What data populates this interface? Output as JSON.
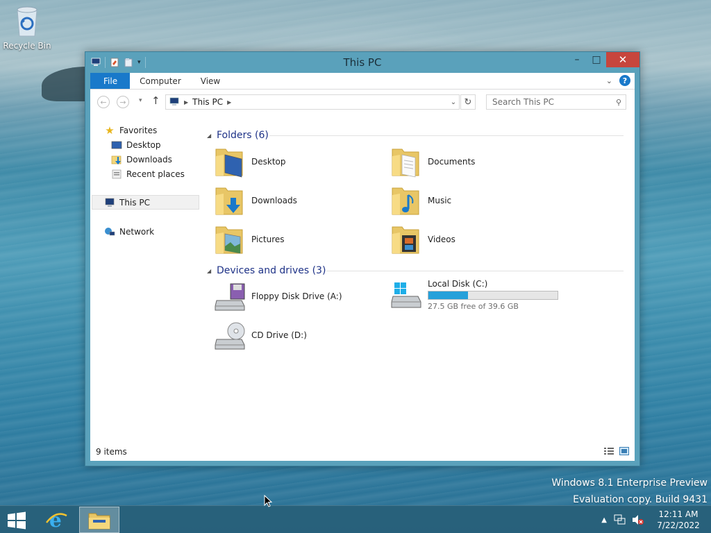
{
  "desktop": {
    "recycle_bin_label": "Recycle Bin",
    "watermark": {
      "line1": "Windows 8.1 Enterprise Preview",
      "line2": "Evaluation copy. Build 9431"
    }
  },
  "window": {
    "title": "This PC",
    "controls": {
      "minimize": "–",
      "maximize": "□",
      "close": "✕"
    },
    "ribbon": {
      "tabs": [
        "File",
        "Computer",
        "View"
      ],
      "help_label": "?"
    },
    "address": {
      "crumb": "This PC",
      "search_placeholder": "Search This PC"
    },
    "nav": {
      "favorites": "Favorites",
      "desktop": "Desktop",
      "downloads": "Downloads",
      "recent": "Recent places",
      "this_pc": "This PC",
      "network": "Network"
    },
    "folders_header": "Folders (6)",
    "folders": [
      {
        "label": "Desktop",
        "icon": "folder-desktop-icon"
      },
      {
        "label": "Documents",
        "icon": "folder-documents-icon"
      },
      {
        "label": "Downloads",
        "icon": "folder-downloads-icon"
      },
      {
        "label": "Music",
        "icon": "folder-music-icon"
      },
      {
        "label": "Pictures",
        "icon": "folder-pictures-icon"
      },
      {
        "label": "Videos",
        "icon": "folder-videos-icon"
      }
    ],
    "devices_header": "Devices and drives (3)",
    "devices": [
      {
        "label": "Floppy Disk Drive (A:)",
        "icon": "floppy-drive-icon"
      },
      {
        "label": "Local Disk (C:)",
        "icon": "local-disk-icon",
        "free_text": "27.5 GB free of 39.6 GB",
        "used_fraction": 0.306
      },
      {
        "label": "CD Drive (D:)",
        "icon": "cd-drive-icon"
      }
    ],
    "status": "9 items"
  },
  "taskbar": {
    "clock_time": "12:11 AM",
    "clock_date": "7/22/2022"
  },
  "colors": {
    "accent": "#1979ca",
    "close": "#c7463d",
    "drive_fill": "#26a0da",
    "frame": "#5aa1bb"
  }
}
